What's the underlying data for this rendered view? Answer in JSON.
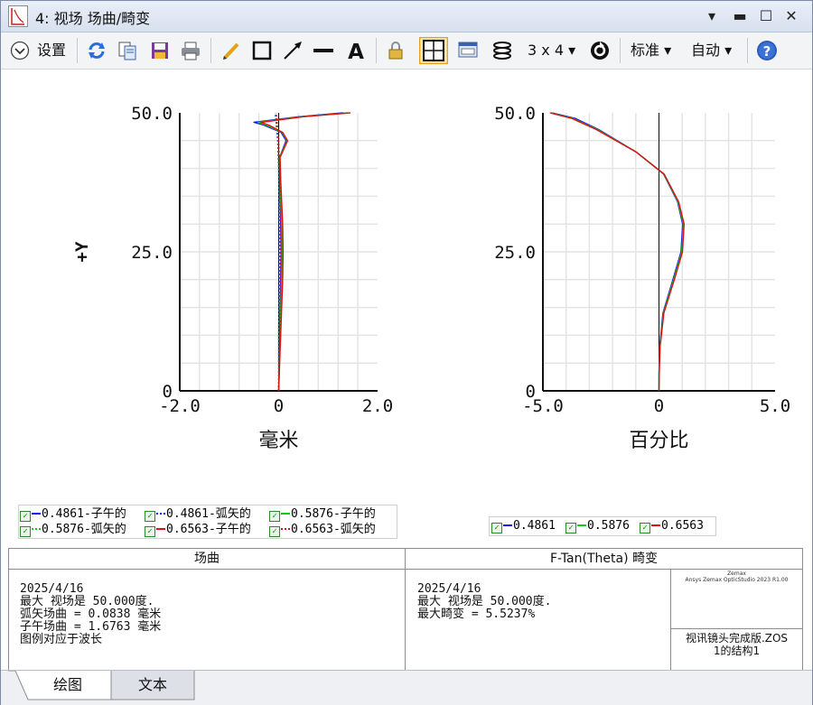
{
  "window": {
    "title": "4: 视场 场曲/畸变"
  },
  "toolbar": {
    "settings_label": "设置",
    "grid_label": "3 x 4",
    "standard_label": "标准",
    "auto_label": "自动"
  },
  "colors": {
    "blue": "#1414ff",
    "green": "#11cc11",
    "red": "#e01010",
    "grid": "#e4e4e4"
  },
  "chart_data": [
    {
      "type": "line",
      "name": "field-curvature",
      "xlabel": "毫米",
      "ylabel": "+Y",
      "xlim": [
        -2.0,
        2.0
      ],
      "ylim": [
        0,
        50.0
      ],
      "xticks": [
        "-2.0",
        "0",
        "2.0"
      ],
      "yticks": [
        "0",
        "25.0",
        "50.0"
      ],
      "grid": true,
      "series": [
        {
          "name": "0.4861-子午的",
          "color": "#1414ff",
          "dash": "",
          "points": [
            [
              0,
              0
            ],
            [
              0.02,
              10
            ],
            [
              0.04,
              20
            ],
            [
              0.05,
              25
            ],
            [
              0.04,
              30
            ],
            [
              0.02,
              38
            ],
            [
              0.02,
              42
            ],
            [
              0.15,
              45
            ],
            [
              0.05,
              46.5
            ],
            [
              -0.3,
              47.8
            ],
            [
              -0.5,
              48.3
            ],
            [
              0.4,
              49.3
            ],
            [
              1.3,
              50
            ]
          ]
        },
        {
          "name": "0.4861-弧矢的",
          "color": "#1414ff",
          "dash": "2,2",
          "points": [
            [
              0,
              0
            ],
            [
              0.0,
              10
            ],
            [
              0.01,
              20
            ],
            [
              0.01,
              30
            ],
            [
              0.0,
              40
            ],
            [
              -0.02,
              45
            ],
            [
              -0.05,
              48
            ],
            [
              -0.07,
              50
            ]
          ]
        },
        {
          "name": "0.5876-子午的",
          "color": "#11cc11",
          "dash": "",
          "points": [
            [
              0,
              0
            ],
            [
              0.03,
              10
            ],
            [
              0.06,
              20
            ],
            [
              0.07,
              25
            ],
            [
              0.06,
              30
            ],
            [
              0.03,
              38
            ],
            [
              0.02,
              42
            ],
            [
              0.17,
              45
            ],
            [
              0.07,
              46.5
            ],
            [
              -0.25,
              47.8
            ],
            [
              -0.42,
              48.3
            ],
            [
              0.45,
              49.3
            ],
            [
              1.4,
              50
            ]
          ]
        },
        {
          "name": "0.5876-弧矢的",
          "color": "#11cc11",
          "dash": "2,2",
          "points": [
            [
              0,
              0
            ],
            [
              0.01,
              10
            ],
            [
              0.02,
              20
            ],
            [
              0.02,
              30
            ],
            [
              0.01,
              40
            ],
            [
              -0.01,
              45
            ],
            [
              -0.04,
              48
            ],
            [
              -0.06,
              50
            ]
          ]
        },
        {
          "name": "0.6563-子午的",
          "color": "#e01010",
          "dash": "",
          "points": [
            [
              0,
              0
            ],
            [
              0.04,
              10
            ],
            [
              0.08,
              20
            ],
            [
              0.09,
              25
            ],
            [
              0.08,
              30
            ],
            [
              0.04,
              38
            ],
            [
              0.03,
              42
            ],
            [
              0.18,
              45
            ],
            [
              0.08,
              46.5
            ],
            [
              -0.2,
              47.8
            ],
            [
              -0.36,
              48.3
            ],
            [
              0.5,
              49.3
            ],
            [
              1.45,
              50
            ]
          ]
        },
        {
          "name": "0.6563-弧矢的",
          "color": "#e01010",
          "dash": "2,2",
          "points": [
            [
              0,
              0
            ],
            [
              0.02,
              10
            ],
            [
              0.03,
              20
            ],
            [
              0.03,
              30
            ],
            [
              0.02,
              40
            ],
            [
              0.0,
              45
            ],
            [
              -0.03,
              48
            ],
            [
              -0.05,
              50
            ]
          ]
        }
      ]
    },
    {
      "type": "line",
      "name": "distortion",
      "xlabel": "百分比",
      "ylabel": "",
      "xlim": [
        -5.0,
        5.0
      ],
      "ylim": [
        0,
        50.0
      ],
      "xticks": [
        "-5.0",
        "0",
        "5.0"
      ],
      "yticks": [
        "0",
        "25.0",
        "50.0"
      ],
      "grid": true,
      "series": [
        {
          "name": "0.4861",
          "color": "#1414ff",
          "dash": "",
          "points": [
            [
              0,
              0
            ],
            [
              0.0,
              3
            ],
            [
              0.03,
              8
            ],
            [
              0.17,
              14
            ],
            [
              0.6,
              20
            ],
            [
              0.95,
              25
            ],
            [
              1.02,
              30
            ],
            [
              0.8,
              34
            ],
            [
              0.2,
              39
            ],
            [
              -1.0,
              43
            ],
            [
              -2.6,
              47
            ],
            [
              -3.6,
              49
            ],
            [
              -4.6,
              50
            ]
          ]
        },
        {
          "name": "0.5876",
          "color": "#11cc11",
          "dash": "",
          "points": [
            [
              0,
              0
            ],
            [
              0.0,
              3
            ],
            [
              0.04,
              8
            ],
            [
              0.19,
              14
            ],
            [
              0.63,
              20
            ],
            [
              0.98,
              25
            ],
            [
              1.05,
              30
            ],
            [
              0.82,
              34
            ],
            [
              0.21,
              39
            ],
            [
              -1.0,
              43
            ],
            [
              -2.65,
              47
            ],
            [
              -3.7,
              49
            ],
            [
              -4.65,
              50
            ]
          ]
        },
        {
          "name": "0.6563",
          "color": "#e01010",
          "dash": "",
          "points": [
            [
              0,
              0
            ],
            [
              0.01,
              3
            ],
            [
              0.05,
              8
            ],
            [
              0.21,
              14
            ],
            [
              0.66,
              20
            ],
            [
              1.01,
              25
            ],
            [
              1.08,
              30
            ],
            [
              0.85,
              34
            ],
            [
              0.22,
              39
            ],
            [
              -1.0,
              43
            ],
            [
              -2.7,
              47
            ],
            [
              -3.75,
              49
            ],
            [
              -4.7,
              50
            ]
          ]
        }
      ]
    }
  ],
  "legend_left": [
    {
      "label": "0.4861-子午的",
      "color": "#1414ff",
      "dash": false
    },
    {
      "label": "0.4861-弧矢的",
      "color": "#1414ff",
      "dash": true
    },
    {
      "label": "0.5876-子午的",
      "color": "#11cc11",
      "dash": false
    },
    {
      "label": "0.5876-弧矢的",
      "color": "#11cc11",
      "dash": true
    },
    {
      "label": "0.6563-子午的",
      "color": "#e01010",
      "dash": false
    },
    {
      "label": "0.6563-弧矢的",
      "color": "#e01010",
      "dash": true
    }
  ],
  "legend_right": [
    {
      "label": "0.4861",
      "color": "#1414ff"
    },
    {
      "label": "0.5876",
      "color": "#11cc11"
    },
    {
      "label": "0.6563",
      "color": "#e01010"
    }
  ],
  "info": {
    "left_header": "场曲",
    "left_text": "2025/4/16\n最大 视场是 50.000度.\n弧矢场曲 = 0.0838 毫米\n子午场曲 = 1.6763 毫米\n图例对应于波长",
    "mid_header": "F-Tan(Theta) 畸变",
    "mid_text": "2025/4/16\n最大 视场是 50.000度.\n最大畸变 = 5.5237%",
    "logo_line1": "Zemax",
    "logo_line2": "Ansys Zemax OpticStudio 2023 R1.00",
    "file_line1": "视讯镜头完成版.ZOS",
    "file_line2": "1的结构1"
  },
  "tabs": {
    "plot_label": "绘图",
    "text_label": "文本"
  }
}
